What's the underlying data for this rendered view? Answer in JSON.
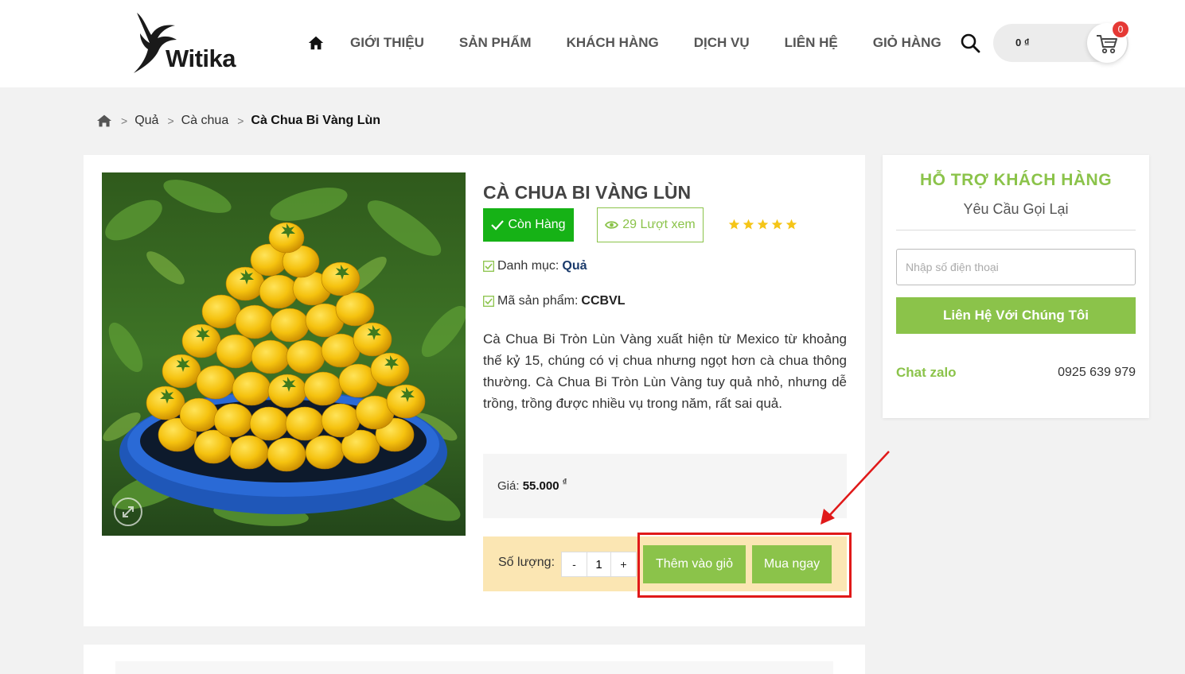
{
  "header": {
    "logo_text": "Witika",
    "nav": [
      {
        "label": "GIỚI THIỆU"
      },
      {
        "label": "SẢN PHẨM"
      },
      {
        "label": "KHÁCH HÀNG"
      },
      {
        "label": "DỊCH VỤ"
      },
      {
        "label": "LIÊN HỆ"
      },
      {
        "label": "GIỎ HÀNG"
      }
    ],
    "cart_total": "0 ₫",
    "cart_count": "0",
    "icons": {
      "home": "home-icon",
      "search": "search-icon",
      "cart": "cart-icon"
    }
  },
  "breadcrumb": {
    "items": [
      "Quả",
      "Cà chua"
    ],
    "current": "Cà Chua Bi Vàng Lùn",
    "separator": ">"
  },
  "product": {
    "title": "CÀ CHUA BI VÀNG LÙN",
    "stock_label": "Còn Hàng",
    "views_label": "29 Lượt xem",
    "rating_stars": 5,
    "category_label": "Danh mục:",
    "category_value": "Quả",
    "sku_label": "Mã sản phẩm:",
    "sku_value": "CCBVL",
    "description": "Cà Chua Bi Tròn Lùn Vàng xuất hiện từ Mexico từ khoảng thế kỷ 15, chúng có vị chua nhưng ngọt hơn cà chua thông thường. Cà Chua Bi Tròn Lùn Vàng tuy quả nhỏ, nhưng dễ trồng, trồng được nhiều vụ trong năm, rất sai quả.",
    "price_label": "Giá:",
    "price_value": "55.000",
    "price_currency": "₫",
    "qty_label": "Số lượng:",
    "qty_minus": "-",
    "qty_value": "1",
    "qty_plus": "+",
    "add_to_cart_label": "Thêm vào giỏ",
    "buy_now_label": "Mua ngay"
  },
  "sidebar": {
    "title": "HỖ TRỢ KHÁCH HÀNG",
    "subtitle": "Yêu Cầu Gọi Lại",
    "phone_placeholder": "Nhập số điện thoại",
    "contact_button": "Liên Hệ Với Chúng Tôi",
    "chat_label": "Chat zalo",
    "hotline": "0925 639 979"
  },
  "colors": {
    "accent_green": "#8bc34a",
    "stock_green": "#16b216",
    "highlight_red": "#e01919",
    "star_yellow": "#f5c518",
    "buy_box_bg": "#fbe6b3"
  }
}
